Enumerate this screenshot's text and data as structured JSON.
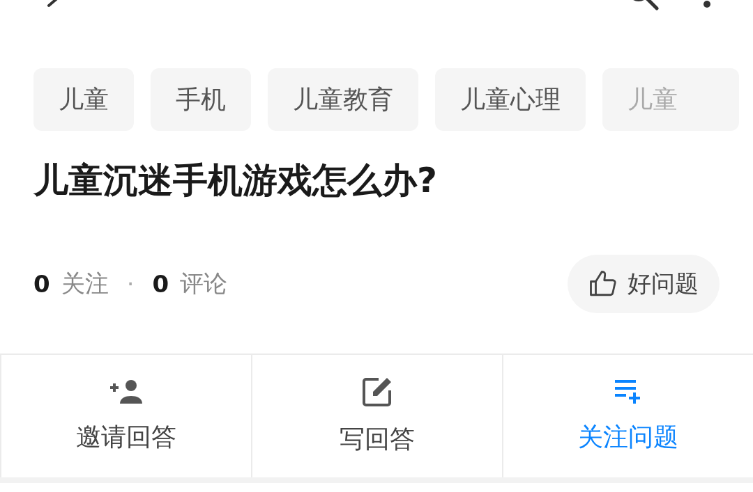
{
  "tags": [
    {
      "label": "儿童"
    },
    {
      "label": "手机"
    },
    {
      "label": "儿童教育"
    },
    {
      "label": "儿童心理"
    },
    {
      "label": "儿童"
    }
  ],
  "question": {
    "title": "儿童沉迷手机游戏怎么办?"
  },
  "stats": [
    {
      "count": "0",
      "label": "关注"
    },
    {
      "count": "0",
      "label": "评论"
    }
  ],
  "stats_separator": "·",
  "good_question_button": {
    "label": "好问题"
  },
  "actions": [
    {
      "kind": "invite",
      "label": "邀请回答",
      "highlighted": false
    },
    {
      "kind": "write",
      "label": "写回答",
      "highlighted": false
    },
    {
      "kind": "follow",
      "label": "关注问题",
      "highlighted": true
    }
  ]
}
